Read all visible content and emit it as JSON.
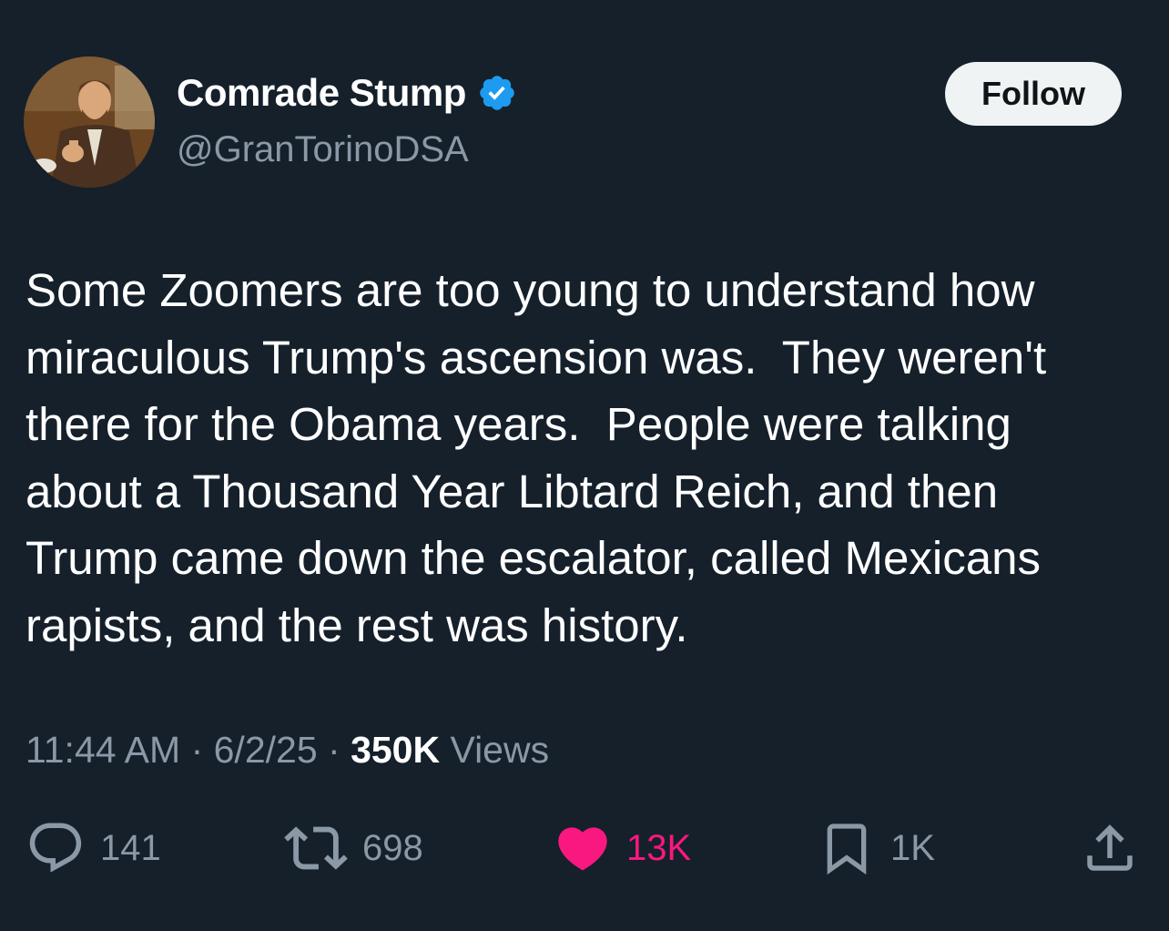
{
  "user": {
    "display_name": "Comrade Stump",
    "handle": "@GranTorinoDSA",
    "verified_icon": "verified-badge-icon",
    "avatar": "profile-photo"
  },
  "follow_label": "Follow",
  "tweet": {
    "text": "Some Zoomers are too young to understand how\nmiraculous Trump's ascension was.  They weren't\nthere for the Obama years.  People were talking\nabout a Thousand Year Libtard Reich, and then\nTrump came down the escalator, called Mexicans\nrapists, and the rest was history."
  },
  "meta": {
    "time": "11:44 AM",
    "sep1": " · ",
    "date": "6/2/25",
    "sep2": " · ",
    "views_count": "350K",
    "views_label": " Views"
  },
  "actions": {
    "replies": "141",
    "reposts": "698",
    "likes": "13K",
    "bookmarks": "1K"
  },
  "colors": {
    "background": "#15202b",
    "accent_blue": "#1d9bf0",
    "like_pink": "#f91880",
    "muted": "#8b98a5"
  }
}
